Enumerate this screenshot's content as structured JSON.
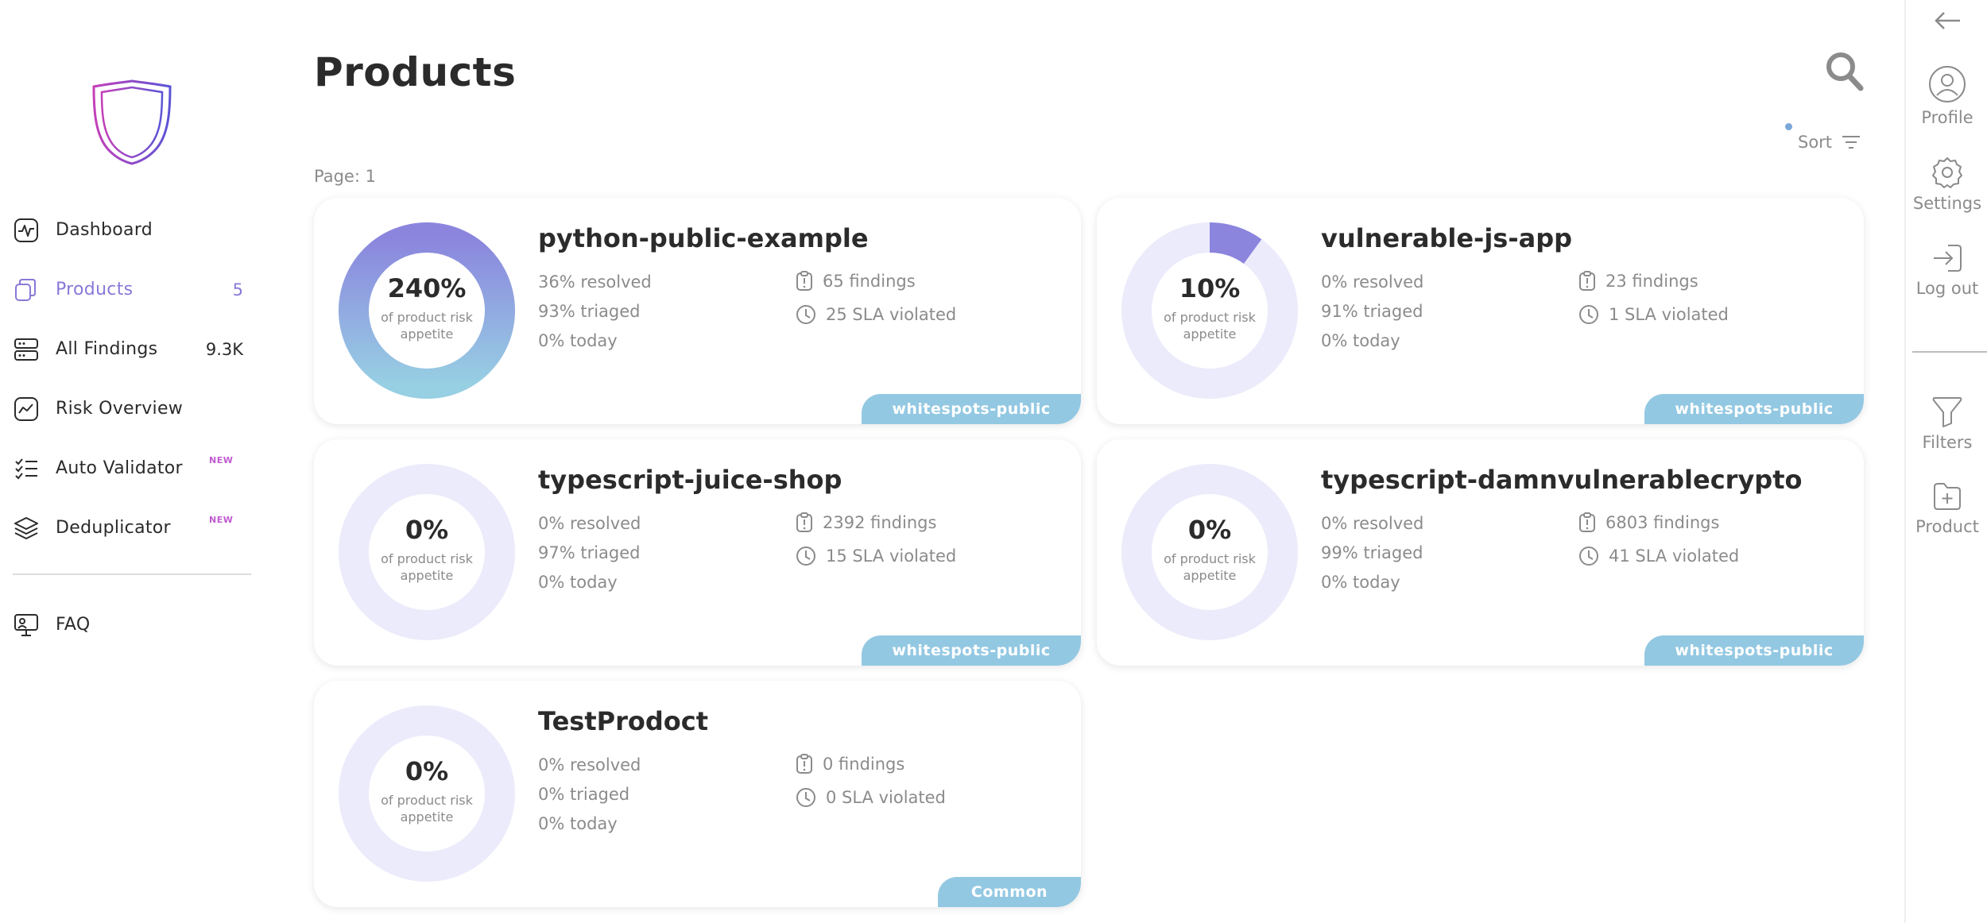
{
  "sidebar": {
    "items": [
      {
        "label": "Dashboard",
        "icon": "pulse-icon"
      },
      {
        "label": "Products",
        "count": "5",
        "icon": "products-icon",
        "active": true
      },
      {
        "label": "All Findings",
        "count": "9.3K",
        "icon": "server-icon"
      },
      {
        "label": "Risk Overview",
        "icon": "trend-icon"
      },
      {
        "label": "Auto Validator",
        "badge": "NEW",
        "icon": "checklist-icon"
      },
      {
        "label": "Deduplicator",
        "badge": "NEW",
        "icon": "layers-icon"
      }
    ],
    "faq": {
      "label": "FAQ",
      "icon": "presentation-icon"
    }
  },
  "main": {
    "title": "Products",
    "sort_label": "Sort",
    "page_indicator": "Page: 1"
  },
  "products": [
    {
      "name": "python-public-example",
      "risk_percent": 240,
      "risk_label": "240%",
      "risk_caption": "of product risk appetite",
      "resolved": "36% resolved",
      "triaged": "93% triaged",
      "today": "0% today",
      "findings": "65 findings",
      "sla": "25 SLA violated",
      "tag": "whitespots-public"
    },
    {
      "name": "vulnerable-js-app",
      "risk_percent": 10,
      "risk_label": "10%",
      "risk_caption": "of product risk appetite",
      "resolved": "0% resolved",
      "triaged": "91% triaged",
      "today": "0% today",
      "findings": "23 findings",
      "sla": "1 SLA violated",
      "tag": "whitespots-public"
    },
    {
      "name": "typescript-juice-shop",
      "risk_percent": 0,
      "risk_label": "0%",
      "risk_caption": "of product risk appetite",
      "resolved": "0% resolved",
      "triaged": "97% triaged",
      "today": "0% today",
      "findings": "2392 findings",
      "sla": "15 SLA violated",
      "tag": "whitespots-public"
    },
    {
      "name": "typescript-damnvulnerablecrypto",
      "risk_percent": 0,
      "risk_label": "0%",
      "risk_caption": "of product risk appetite",
      "resolved": "0% resolved",
      "triaged": "99% triaged",
      "today": "0% today",
      "findings": "6803 findings",
      "sla": "41 SLA violated",
      "tag": "whitespots-public"
    },
    {
      "name": "TestProdoct",
      "risk_percent": 0,
      "risk_label": "0%",
      "risk_caption": "of product risk appetite",
      "resolved": "0% resolved",
      "triaged": "0% triaged",
      "today": "0% today",
      "findings": "0 findings",
      "sla": "0 SLA violated",
      "tag": "Common"
    }
  ],
  "rail": {
    "profile": "Profile",
    "settings": "Settings",
    "logout": "Log out",
    "filters": "Filters",
    "product": "Product"
  },
  "colors": {
    "accent": "#8a78d8",
    "donut_track": "#ecebfb",
    "donut_fill_top": "#8b85de",
    "donut_fill_bottom": "#97cfe3",
    "tag_bg": "#93c8e2",
    "new_badge": "#c05bd0",
    "muted_text": "#8b8b8b"
  }
}
